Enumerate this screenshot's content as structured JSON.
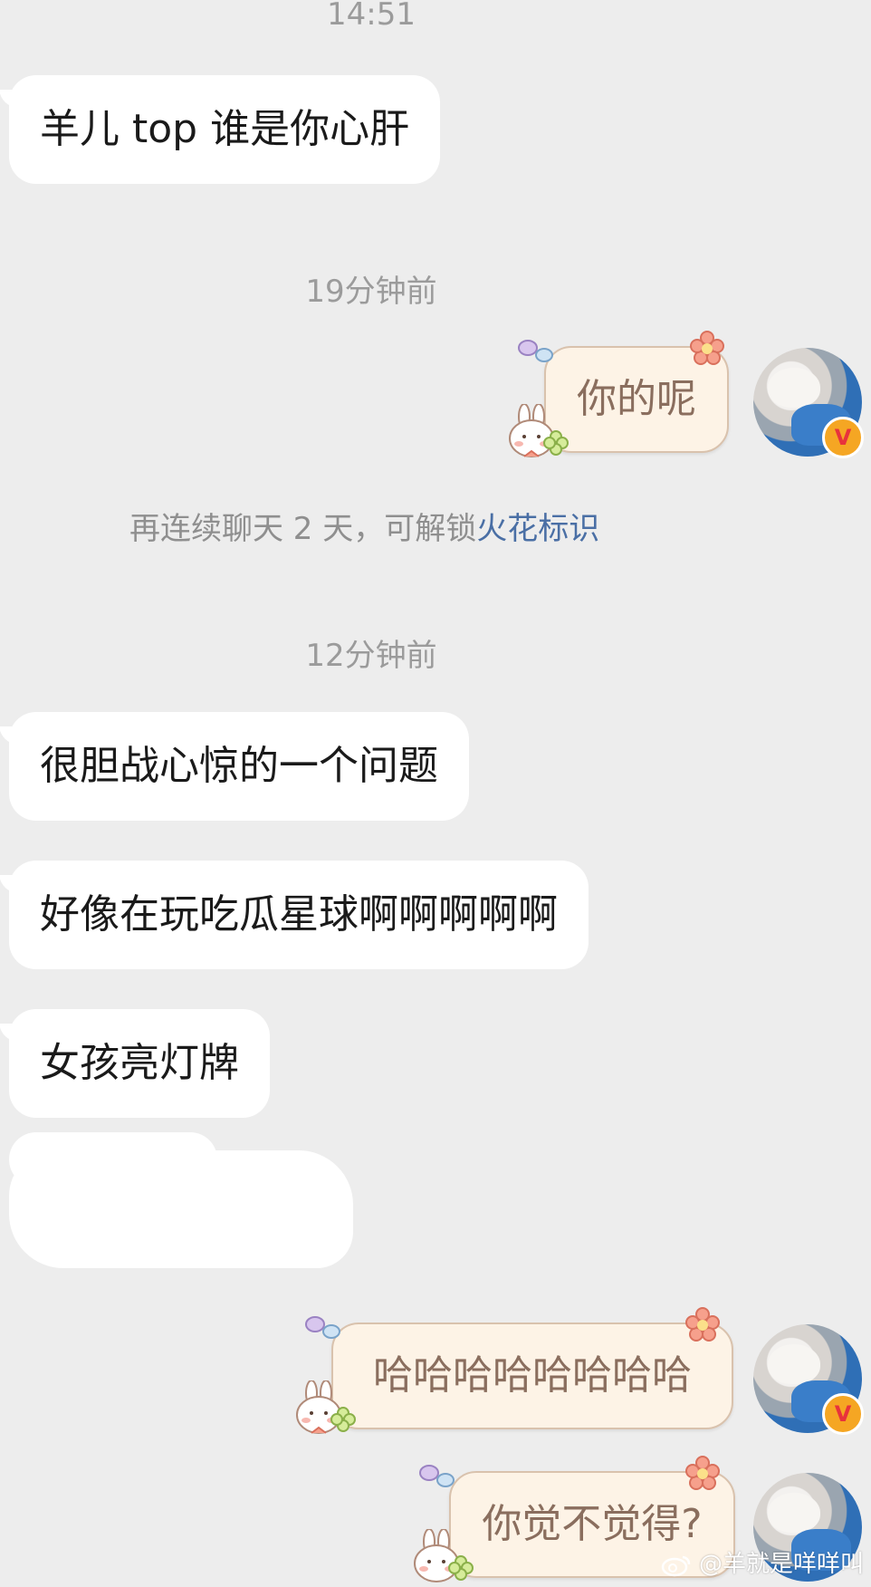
{
  "timestamps": {
    "t1": "14:51",
    "t2": "19分钟前",
    "t3": "12分钟前"
  },
  "messages": {
    "left_1": "羊儿 top 谁是你心肝",
    "right_1": "你的呢",
    "left_2": "很胆战心惊的一个问题",
    "left_3": "好像在玩吃瓜星球啊啊啊啊啊",
    "left_4": "女孩亮灯牌",
    "right_2": "哈哈哈哈哈哈哈哈",
    "right_3": "你觉不觉得?"
  },
  "hint": {
    "prefix": "再连续聊天 2 天，可解锁",
    "link": "火花标识"
  },
  "avatar": {
    "badge": "V",
    "badge_color": "#f5a623"
  },
  "watermark": "@羊就是咩咩叫",
  "colors": {
    "background": "#ededed",
    "left_bubble": "#ffffff",
    "right_bubble": "#fdf3e6",
    "right_text": "#8a6e5e",
    "link": "#4a6fa5"
  },
  "icons": [
    "butterfly-icon",
    "flower-icon",
    "bunny-sticker-icon",
    "clover-icon",
    "weibo-logo-icon"
  ]
}
